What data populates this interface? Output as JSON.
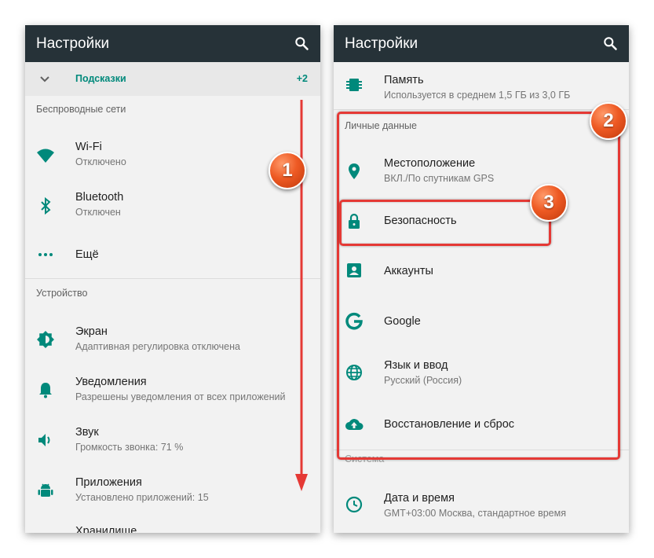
{
  "left_panel": {
    "title": "Настройки",
    "hints": {
      "label": "Подсказки",
      "count": "+2"
    },
    "section_wireless": "Беспроводные сети",
    "section_device": "Устройство",
    "items": [
      {
        "title": "Wi-Fi",
        "subtitle": "Отключено"
      },
      {
        "title": "Bluetooth",
        "subtitle": "Отключен"
      },
      {
        "title": "Ещё"
      },
      {
        "title": "Экран",
        "subtitle": "Адаптивная регулировка отключена"
      },
      {
        "title": "Уведомления",
        "subtitle": "Разрешены уведомления от всех приложений"
      },
      {
        "title": "Звук",
        "subtitle": "Громкость звонка: 71 %"
      },
      {
        "title": "Приложения",
        "subtitle": "Установлено приложений: 15"
      },
      {
        "title": "Хранилище"
      }
    ]
  },
  "right_panel": {
    "title": "Настройки",
    "section_personal": "Личные данные",
    "section_system": "Система",
    "items": [
      {
        "title": "Память",
        "subtitle": "Используется в среднем 1,5 ГБ из 3,0 ГБ"
      },
      {
        "title": "Местоположение",
        "subtitle": "ВКЛ./По спутникам GPS"
      },
      {
        "title": "Безопасность"
      },
      {
        "title": "Аккаунты"
      },
      {
        "title": "Google"
      },
      {
        "title": "Язык и ввод",
        "subtitle": "Русский (Россия)"
      },
      {
        "title": "Восстановление и сброс"
      },
      {
        "title": "Дата и время",
        "subtitle": "GMT+03:00 Москва, стандартное время"
      }
    ]
  },
  "annotations": {
    "badge_1": "1",
    "badge_2": "2",
    "badge_3": "3"
  },
  "colors": {
    "appbar": "#263238",
    "accent": "#00897b",
    "annotation_red": "#e53935"
  }
}
